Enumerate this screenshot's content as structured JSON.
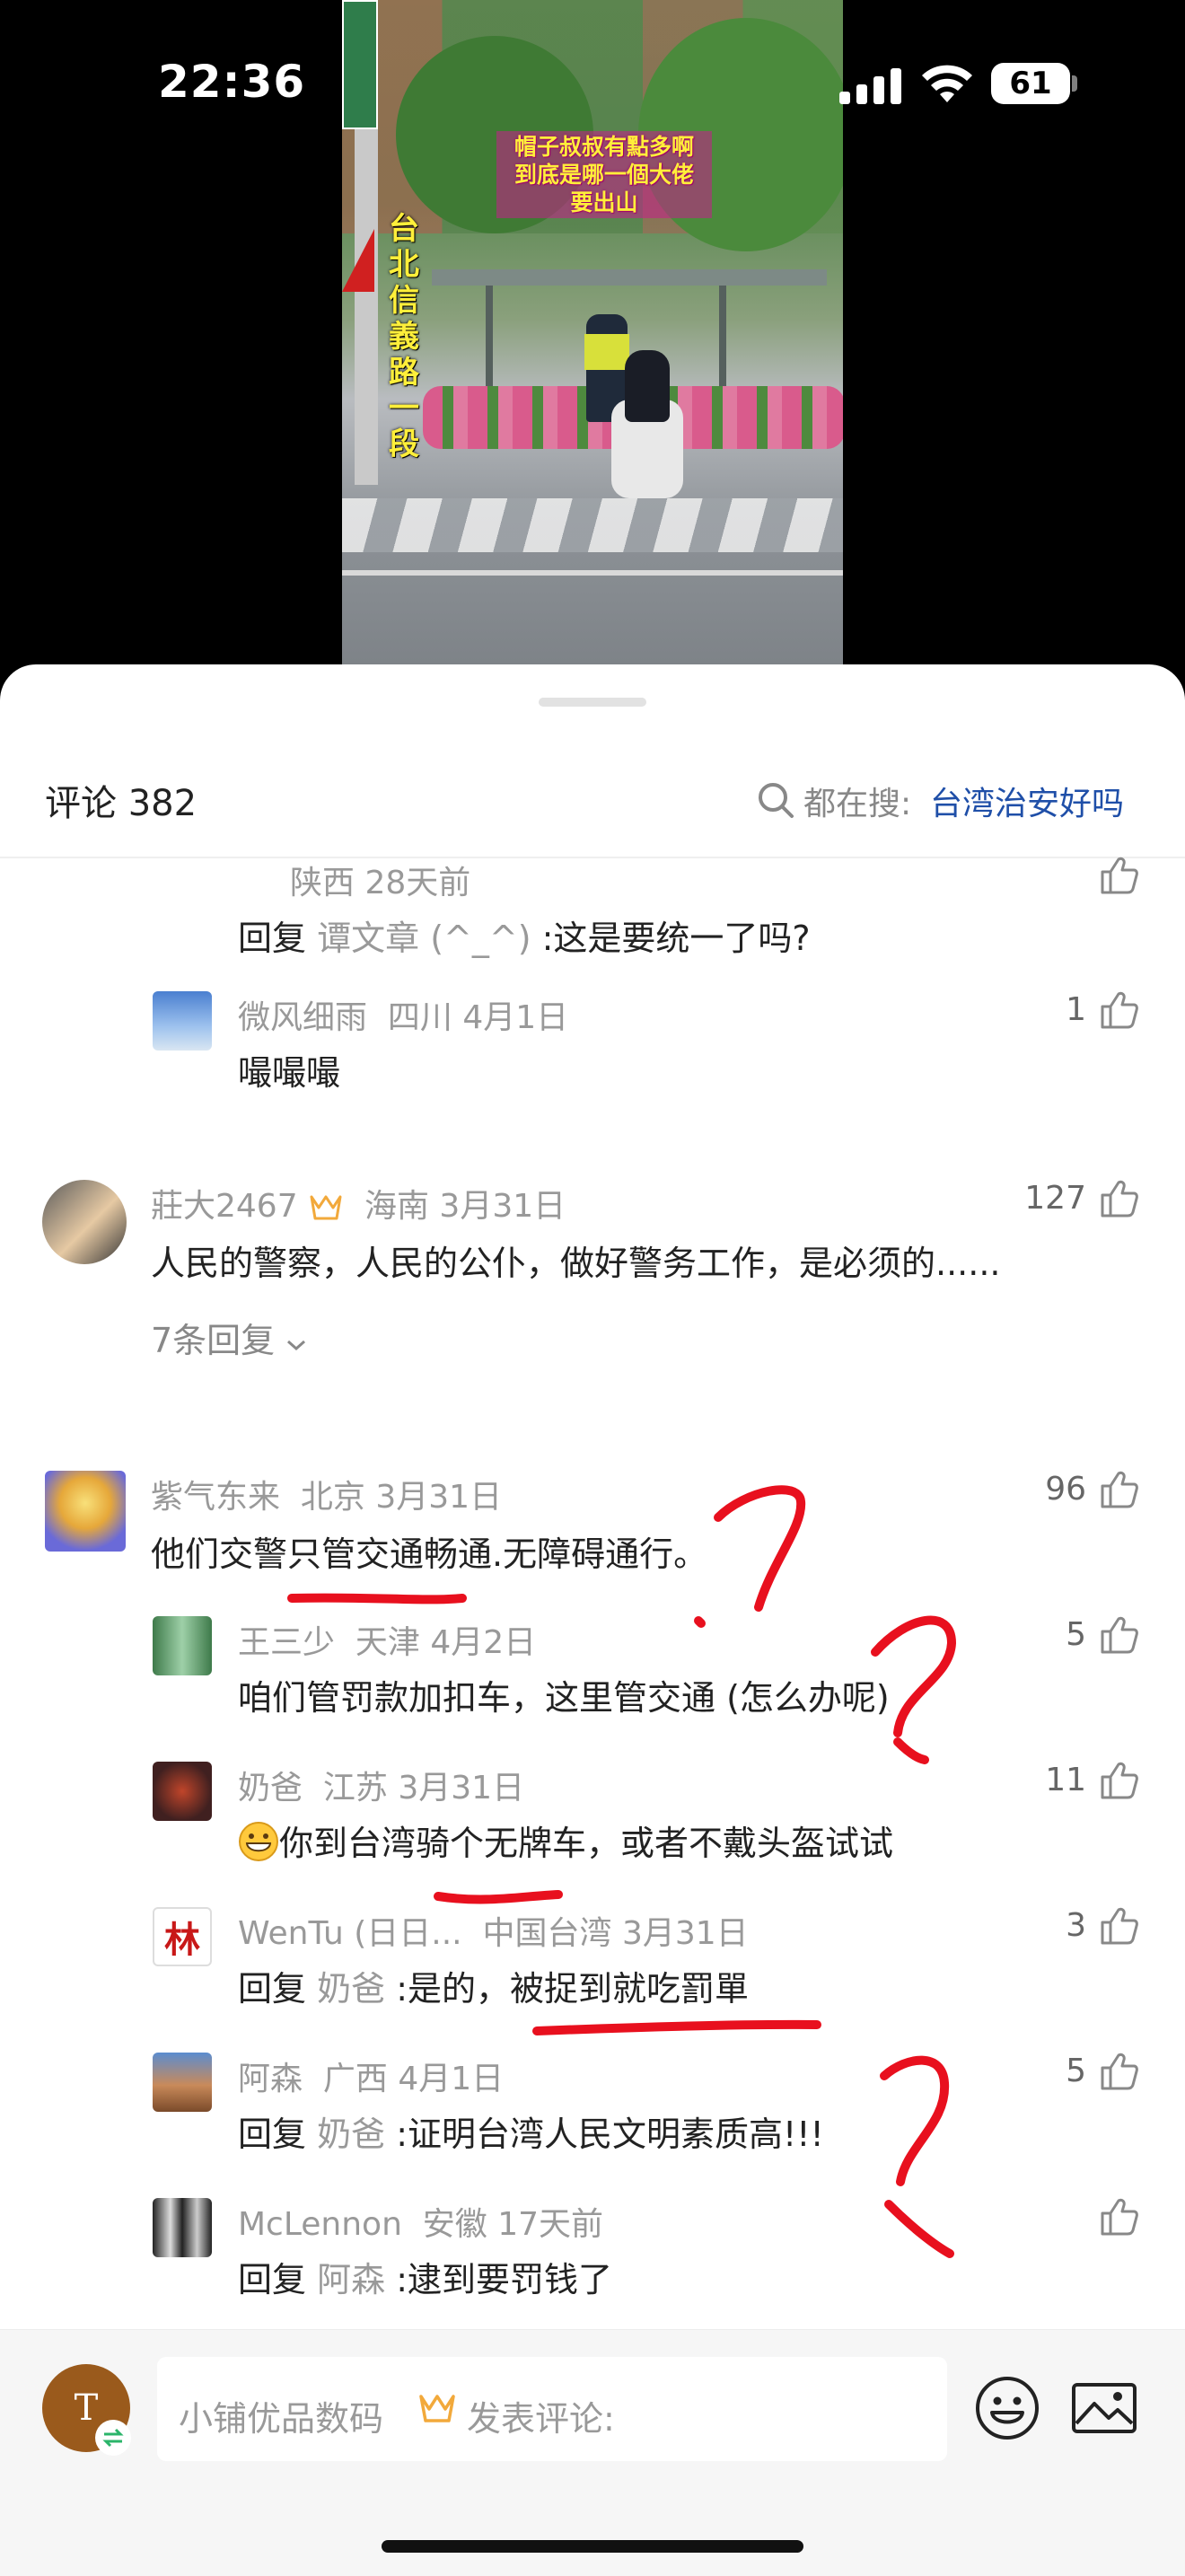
{
  "status_bar": {
    "time": "22:36",
    "battery": "61"
  },
  "video": {
    "caption": "帽子叔叔有點多啊\n到底是哪一個大佬\n要出山",
    "place_label": "台\n北\n信\n義\n路\n一\n段"
  },
  "header": {
    "comment_count_label": "评论 382",
    "search_prefix": "都在搜:",
    "search_term": "台湾治安好吗"
  },
  "comments": [
    {
      "meta": "陕西 28天前",
      "reply_prefix": "回复",
      "reply_to": "谭文章 (^_^)",
      "text": ":这是要统一了吗?",
      "likes": ""
    },
    {
      "user": "微风细雨",
      "meta": "四川 4月1日",
      "text": "嘬嘬嘬",
      "likes": "1"
    },
    {
      "user": "莊大2467",
      "meta": "海南 3月31日",
      "text": "人民的警察，人民的公仆，做好警务工作，是必须的......",
      "likes": "127",
      "more": "7条回复"
    },
    {
      "user": "紫气东来",
      "meta": "北京 3月31日",
      "text": "他们交警只管交通畅通.无障碍通行。",
      "likes": "96"
    },
    {
      "user": "王三少",
      "meta": "天津 4月2日",
      "text": "咱们管罚款加扣车，这里管交通 (怎么办呢)",
      "likes": "5"
    },
    {
      "user": "奶爸",
      "meta": "江苏 3月31日",
      "text": "你到台湾骑个无牌车，或者不戴头盔试试",
      "likes": "11"
    },
    {
      "user": "WenTu (日日...",
      "meta": "中国台湾 3月31日",
      "reply_prefix": "回复",
      "reply_to": "奶爸",
      "text": ":是的，被捉到就吃罰單",
      "likes": "3",
      "avatar_char": "林"
    },
    {
      "user": "阿森",
      "meta": "广西 4月1日",
      "reply_prefix": "回复",
      "reply_to": "奶爸",
      "text": ":证明台湾人民文明素质高!!!",
      "likes": "5"
    },
    {
      "user": "McLennon",
      "meta": "安徽 17天前",
      "reply_prefix": "回复",
      "reply_to": "阿森",
      "text": ":逮到要罚钱了",
      "likes": ""
    }
  ],
  "composer": {
    "username": "小铺优品数码",
    "placeholder": "发表评论:",
    "avatar_letter": "T"
  },
  "colors": {
    "link_blue": "#1f4fa8",
    "annotation_red": "#e8101e",
    "crown_gold": "#f2a93b"
  }
}
